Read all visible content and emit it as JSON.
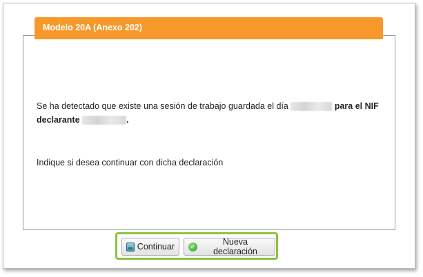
{
  "dialog": {
    "title": "Modelo 20A (Anexo 202)",
    "message_part1": "Se ha detectado que existe una sesión de trabajo guardada el día",
    "message_part2": "para el NIF declarante",
    "message_end": ".",
    "instruction": "Indique si desea continuar con dicha declaración"
  },
  "buttons": {
    "continue_label": "Continuar",
    "new_label": "Nueva declaración"
  },
  "colors": {
    "header": "#f7982a",
    "highlight_border": "#8cc43c"
  },
  "icons": {
    "continue": "document-icon",
    "new": "check-circle-icon"
  }
}
